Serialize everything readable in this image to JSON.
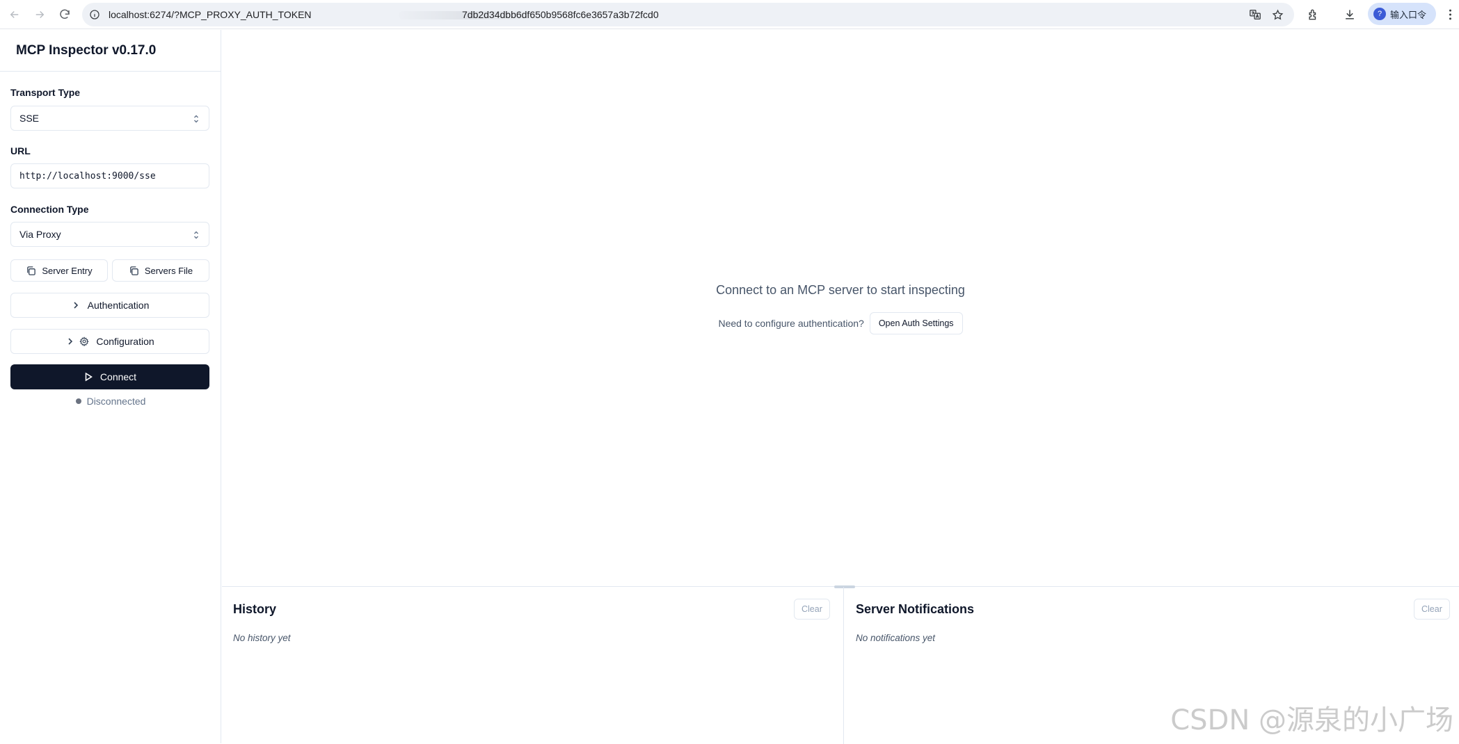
{
  "browser": {
    "url_part1": "localhost:6274/?MCP_PROXY_AUTH_TOKEN",
    "url_part2": "7db2d34dbb6df650b9568fc6e3657a3b72fcd0",
    "profile_label": "输入口令"
  },
  "sidebar": {
    "title": "MCP Inspector v0.17.0",
    "transport_label": "Transport Type",
    "transport_value": "SSE",
    "url_label": "URL",
    "url_value": "http://localhost:9000/sse",
    "connection_label": "Connection Type",
    "connection_value": "Via Proxy",
    "server_entry_label": "Server Entry",
    "servers_file_label": "Servers File",
    "authentication_label": "Authentication",
    "configuration_label": "Configuration",
    "connect_label": "Connect",
    "status_text": "Disconnected"
  },
  "main": {
    "empty_title": "Connect to an MCP server to start inspecting",
    "auth_hint": "Need to configure authentication?",
    "open_auth_label": "Open Auth Settings"
  },
  "history": {
    "title": "History",
    "clear_label": "Clear",
    "empty_text": "No history yet"
  },
  "notifications": {
    "title": "Server Notifications",
    "clear_label": "Clear",
    "empty_text": "No notifications yet"
  },
  "watermark": "CSDN @源泉的小广场",
  "colors": {
    "primary": "#0f172a",
    "border": "#e2e8f0",
    "muted": "#64748b",
    "status_disconnected": "#6b7280"
  }
}
